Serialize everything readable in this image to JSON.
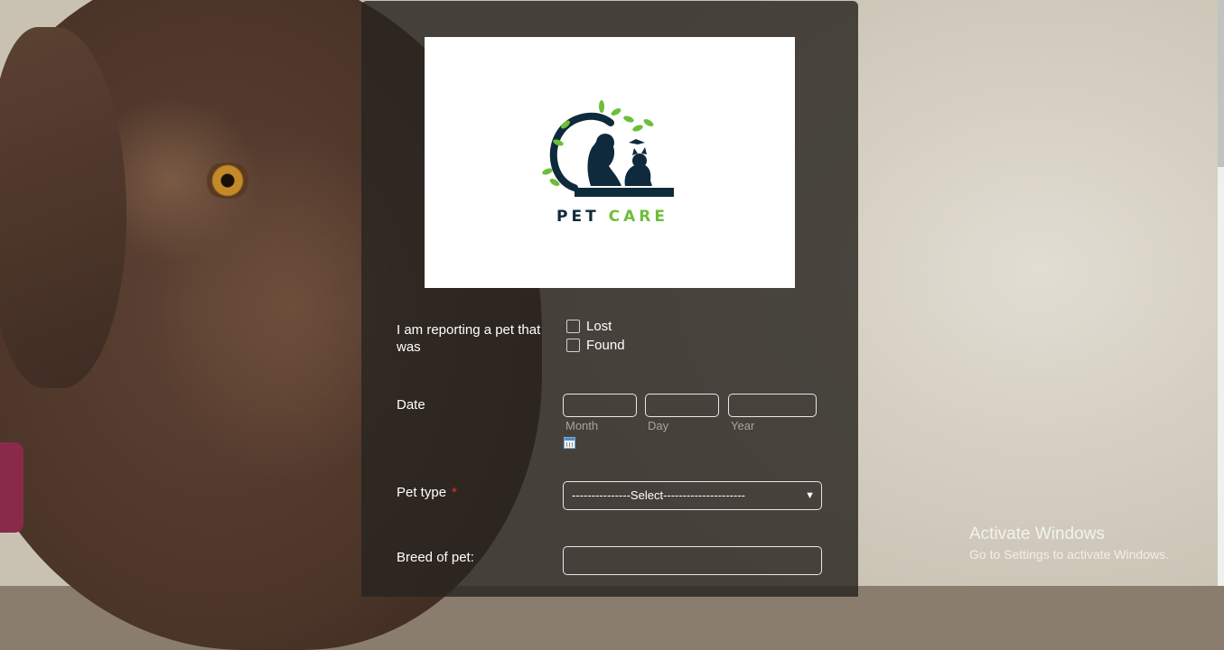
{
  "logo": {
    "word1": "PET",
    "word2": "CARE",
    "icon": "pet-care-logo-icon"
  },
  "form": {
    "report_label": "I am reporting a pet that was",
    "report_options": [
      "Lost",
      "Found"
    ],
    "date_label": "Date",
    "date_sublabels": [
      "Month",
      "Day",
      "Year"
    ],
    "date_picker_icon": "calendar-icon",
    "pet_type_label": "Pet type",
    "pet_type_required": "*",
    "pet_type_select": "---------------Select---------------------",
    "breed_label": "Breed of pet:"
  },
  "watermark": {
    "title": "Activate Windows",
    "subtitle": "Go to Settings to activate Windows."
  },
  "colors": {
    "panel": "#282420",
    "logo_dark": "#0f2a3c",
    "logo_green": "#6cbf3a",
    "required": "#e0312b"
  }
}
